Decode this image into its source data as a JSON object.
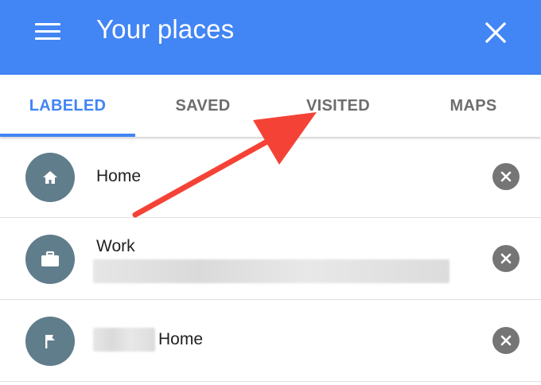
{
  "appbar": {
    "title": "Your places",
    "menu_icon": "menu-icon",
    "close_icon": "close-icon",
    "color": "#4285f4"
  },
  "tabs": [
    {
      "label": "LABELED",
      "active": true
    },
    {
      "label": "SAVED",
      "active": false
    },
    {
      "label": "VISITED",
      "active": false
    },
    {
      "label": "MAPS",
      "active": false
    }
  ],
  "places": [
    {
      "label": "Home",
      "icon": "home-icon",
      "subtitle_redacted": false,
      "remove_icon": "remove-icon"
    },
    {
      "label": "Work",
      "icon": "briefcase-icon",
      "subtitle_redacted": true,
      "remove_icon": "remove-icon"
    },
    {
      "label": "Home",
      "icon": "flag-icon",
      "prefix_redacted": true,
      "remove_icon": "remove-icon"
    }
  ],
  "annotation": {
    "type": "arrow",
    "color": "#f44336",
    "points_to": "VISITED"
  },
  "colors": {
    "accent": "#4285f4",
    "avatar": "#607d8b",
    "remove": "#757575",
    "inactive_tab": "#6d6d6d"
  }
}
